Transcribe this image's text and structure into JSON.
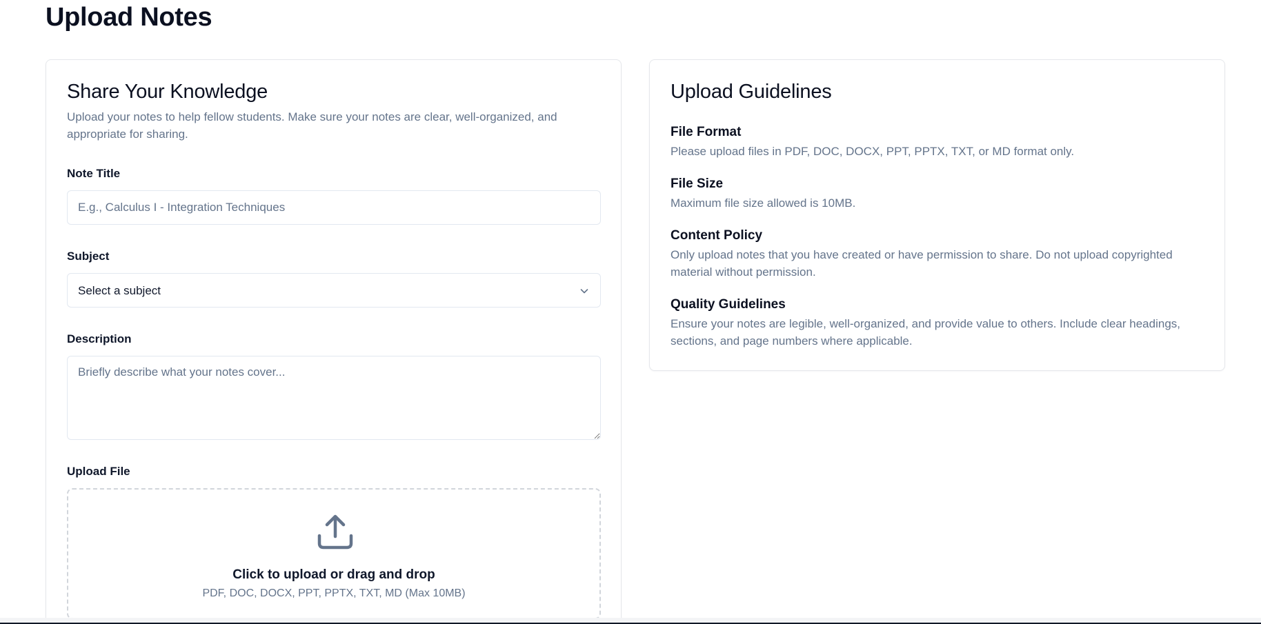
{
  "page": {
    "title": "Upload Notes"
  },
  "form": {
    "heading": "Share Your Knowledge",
    "description": "Upload your notes to help fellow students. Make sure your notes are clear, well-organized, and appropriate for sharing.",
    "note_title": {
      "label": "Note Title",
      "placeholder": "E.g., Calculus I - Integration Techniques",
      "value": ""
    },
    "subject": {
      "label": "Subject",
      "selected": "Select a subject",
      "icon": "chevron-down-icon"
    },
    "description_field": {
      "label": "Description",
      "placeholder": "Briefly describe what your notes cover...",
      "value": ""
    },
    "upload": {
      "label": "Upload File",
      "icon": "upload-icon",
      "title": "Click to upload or drag and drop",
      "hint": "PDF, DOC, DOCX, PPT, PPTX, TXT, MD (Max 10MB)"
    }
  },
  "guidelines": {
    "heading": "Upload Guidelines",
    "items": [
      {
        "title": "File Format",
        "text": "Please upload files in PDF, DOC, DOCX, PPT, PPTX, TXT, or MD format only."
      },
      {
        "title": "File Size",
        "text": "Maximum file size allowed is 10MB."
      },
      {
        "title": "Content Policy",
        "text": "Only upload notes that you have created or have permission to share. Do not upload copyrighted material without permission."
      },
      {
        "title": "Quality Guidelines",
        "text": "Ensure your notes are legible, well-organized, and provide value to others. Include clear headings, sections, and page numbers where applicable."
      }
    ]
  },
  "colors": {
    "text_primary": "#0f172a",
    "text_muted": "#64748b",
    "border": "#e2e8f0",
    "icon": "#64748b"
  }
}
